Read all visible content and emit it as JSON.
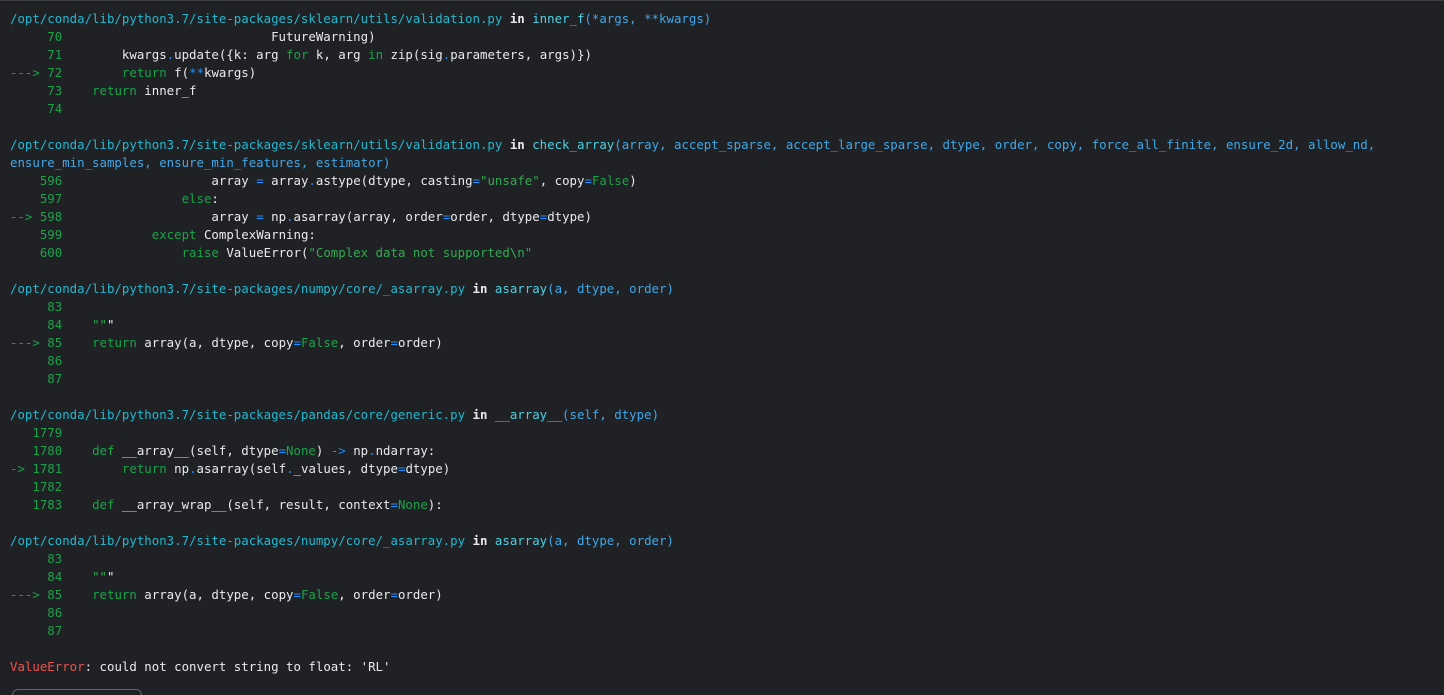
{
  "frames": [
    {
      "path": "/opt/conda/lib/python3.7/site-packages/sklearn/utils/validation.py",
      "in": " in ",
      "func": "inner_f",
      "args": "(*args, **kwargs)",
      "lines": [
        {
          "gutter": "     70",
          "code": "                            FutureWarning)"
        },
        {
          "gutter": "     71",
          "code": "        kwargs.update({k: arg for k, arg in zip(sig.parameters, args)})"
        },
        {
          "gutter": "---> 72",
          "code": "        return f(**kwargs)"
        },
        {
          "gutter": "     73",
          "code": "    return inner_f"
        },
        {
          "gutter": "     74",
          "code": ""
        }
      ]
    },
    {
      "path": "/opt/conda/lib/python3.7/site-packages/sklearn/utils/validation.py",
      "in": " in ",
      "func": "check_array",
      "args": "(array, accept_sparse, accept_large_sparse, dtype, order, copy, force_all_finite, ensure_2d, allow_nd,",
      "args_cont": "ensure_min_samples, ensure_min_features, estimator)",
      "lines": [
        {
          "gutter": "    596",
          "code": "                    array = array.astype(dtype, casting=\"unsafe\", copy=False)"
        },
        {
          "gutter": "    597",
          "code": "                else:"
        },
        {
          "gutter": "--> 598",
          "code": "                    array = np.asarray(array, order=order, dtype=dtype)"
        },
        {
          "gutter": "    599",
          "code": "            except ComplexWarning:"
        },
        {
          "gutter": "    600",
          "code": "                raise ValueError(\"Complex data not supported\\n\""
        }
      ]
    },
    {
      "path": "/opt/conda/lib/python3.7/site-packages/numpy/core/_asarray.py",
      "in": " in ",
      "func": "asarray",
      "args": "(a, dtype, order)",
      "lines": [
        {
          "gutter": "     83",
          "code": ""
        },
        {
          "gutter": "     84",
          "code": "    \"\"\""
        },
        {
          "gutter": "---> 85",
          "code": "    return array(a, dtype, copy=False, order=order)"
        },
        {
          "gutter": "     86",
          "code": ""
        },
        {
          "gutter": "     87",
          "code": ""
        }
      ]
    },
    {
      "path": "/opt/conda/lib/python3.7/site-packages/pandas/core/generic.py",
      "in": " in ",
      "func": "__array__",
      "args": "(self, dtype)",
      "lines": [
        {
          "gutter": "   1779",
          "code": ""
        },
        {
          "gutter": "   1780",
          "code": "    def __array__(self, dtype=None) -> np.ndarray:"
        },
        {
          "gutter": "-> 1781",
          "code": "        return np.asarray(self._values, dtype=dtype)"
        },
        {
          "gutter": "   1782",
          "code": ""
        },
        {
          "gutter": "   1783",
          "code": "    def __array_wrap__(self, result, context=None):"
        }
      ]
    },
    {
      "path": "/opt/conda/lib/python3.7/site-packages/numpy/core/_asarray.py",
      "in": " in ",
      "func": "asarray",
      "args": "(a, dtype, order)",
      "lines": [
        {
          "gutter": "     83",
          "code": ""
        },
        {
          "gutter": "     84",
          "code": "    \"\"\""
        },
        {
          "gutter": "---> 85",
          "code": "    return array(a, dtype, copy=False, order=order)"
        },
        {
          "gutter": "     86",
          "code": ""
        },
        {
          "gutter": "     87",
          "code": ""
        }
      ]
    }
  ],
  "error": {
    "type": "ValueError",
    "message": ": could not convert string to float: 'RL'"
  },
  "colors": {
    "background": "#202124",
    "path": "#22b8cf",
    "line_number": "#1aa34a",
    "error": "#ef5350",
    "keyword": "#e8eaed"
  }
}
